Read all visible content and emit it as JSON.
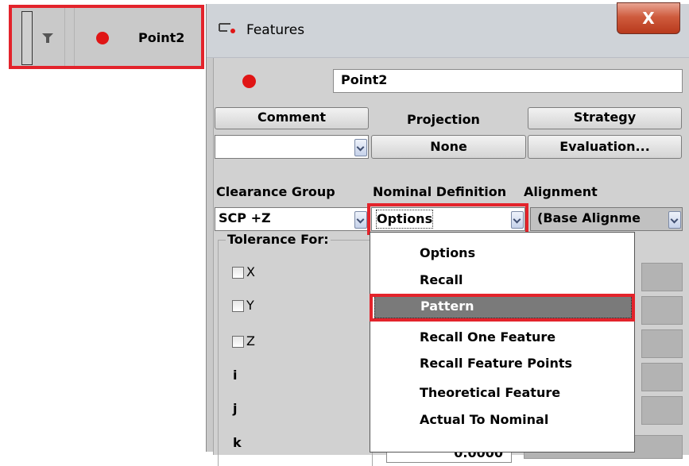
{
  "tree": {
    "feature_label": "Point2"
  },
  "dialog": {
    "title": "Features",
    "close_label": "X",
    "feature_name": "Point2",
    "comment_label": "Comment",
    "projection_label": "Projection",
    "strategy_label": "Strategy",
    "projection_value": "None",
    "evaluation_label": "Evaluation...",
    "clearance_group_label": "Clearance Group",
    "nominal_definition_label": "Nominal Definition",
    "alignment_label": "Alignment",
    "clearance_value": "SCP +Z",
    "nominal_value": "Options",
    "alignment_value": "(Base Alignme",
    "tolerance_for_label": "Tolerance For:",
    "checkbox_labels": [
      "X",
      "Y",
      "Z"
    ],
    "axis_labels": [
      "i",
      "j",
      "k"
    ],
    "k_value": "0.0000"
  },
  "dropdown": {
    "items": [
      "Options",
      "Recall",
      "Pattern",
      "Recall One Feature",
      "Recall Feature Points",
      "Theoretical Feature",
      "Actual To Nominal"
    ],
    "selected_index": 2
  },
  "colors": {
    "highlight": "#e3232b",
    "feature_dot": "#e01515",
    "selected_item_bg": "#7a7a7a"
  }
}
